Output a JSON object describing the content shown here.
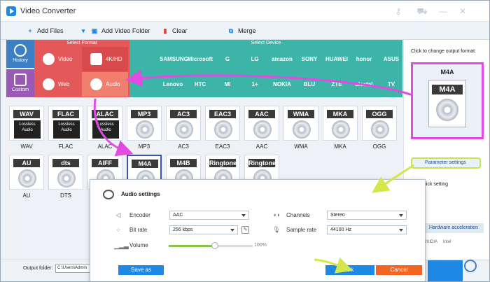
{
  "window": {
    "title": "Video Converter"
  },
  "colors": {
    "accent": "#1e88e5",
    "format_panel": "#e5585a",
    "device_panel": "#3cb5a8",
    "history": "#3d7fc4",
    "custom": "#9b59b6",
    "highlight_magenta": "#e14be0",
    "highlight_yellow": "#c9e34a",
    "cancel": "#f26522"
  },
  "toolbar": {
    "add_files": "Add Files",
    "add_video_folder": "Add Video Folder",
    "clear": "Clear",
    "merge": "Merge"
  },
  "rail": {
    "history": "History",
    "custom": "Custom"
  },
  "sections": {
    "select_format": "Select Format",
    "select_device": "Select Device"
  },
  "format_categories": [
    {
      "label": "Video",
      "icon": "play-icon"
    },
    {
      "label": "4K/HD",
      "icon": "4k-icon"
    },
    {
      "label": "Web",
      "icon": "chrome-icon"
    },
    {
      "label": "Audio",
      "icon": "speaker-icon"
    }
  ],
  "brands_row1": [
    "",
    "SAMSUNG",
    "Microsoft",
    "G",
    "LG",
    "amazon",
    "SONY",
    "HUAWEI",
    "honor",
    "ASUS"
  ],
  "brands_row2": [
    "",
    "Lenovo",
    "HTC",
    "MI",
    "1+",
    "NOKIA",
    "BLU",
    "ZTE",
    "alcatel",
    "TV"
  ],
  "formats_row1": [
    {
      "tag": "WAV",
      "label": "WAV",
      "lossless": true
    },
    {
      "tag": "FLAC",
      "label": "FLAC",
      "lossless": true
    },
    {
      "tag": "ALAC",
      "label": "ALAC",
      "lossless": true
    },
    {
      "tag": "MP3",
      "label": "MP3",
      "lossless": false
    },
    {
      "tag": "AC3",
      "label": "AC3",
      "lossless": false
    },
    {
      "tag": "EAC3",
      "label": "EAC3",
      "lossless": false
    },
    {
      "tag": "AAC",
      "label": "AAC",
      "lossless": false
    },
    {
      "tag": "WMA",
      "label": "WMA",
      "lossless": false
    },
    {
      "tag": "MKA",
      "label": "MKA",
      "lossless": false
    },
    {
      "tag": "OGG",
      "label": "OGG",
      "lossless": false
    }
  ],
  "formats_row2": [
    {
      "tag": "AU",
      "label": "AU"
    },
    {
      "tag": "dts",
      "label": "DTS"
    },
    {
      "tag": "AIFF",
      "label": ""
    },
    {
      "tag": "M4A",
      "label": "",
      "selected": true
    },
    {
      "tag": "M4B",
      "label": ""
    },
    {
      "tag": "Ringtone",
      "label": ""
    },
    {
      "tag": "Ringtone",
      "label": ""
    }
  ],
  "lossless_text": "Lossless Audio",
  "right_panel": {
    "hint": "Click to change output format:",
    "format": "M4A",
    "format_tag": "M4A",
    "parameter_settings": "Parameter settings",
    "quick_setting": "uick setting",
    "hw_accel": "Hardware acceleration",
    "vendor_nvidia": "NVIDIA",
    "vendor_intel": "Intel"
  },
  "bottom": {
    "output_folder_label": "Output folder:",
    "output_path": "C:\\Users\\Admin"
  },
  "dialog": {
    "title": "Audio settings",
    "encoder_label": "Encoder",
    "encoder_value": "AAC",
    "bitrate_label": "Bit rate",
    "bitrate_value": "256 kbps",
    "volume_label": "Volume",
    "volume_value": "100%",
    "volume_level": 0.55,
    "channels_label": "Channels",
    "channels_value": "Stereo",
    "samplerate_label": "Sample rate",
    "samplerate_value": "44100 Hz",
    "save_as": "Save as",
    "ok": "Ok",
    "cancel": "Cancel"
  }
}
